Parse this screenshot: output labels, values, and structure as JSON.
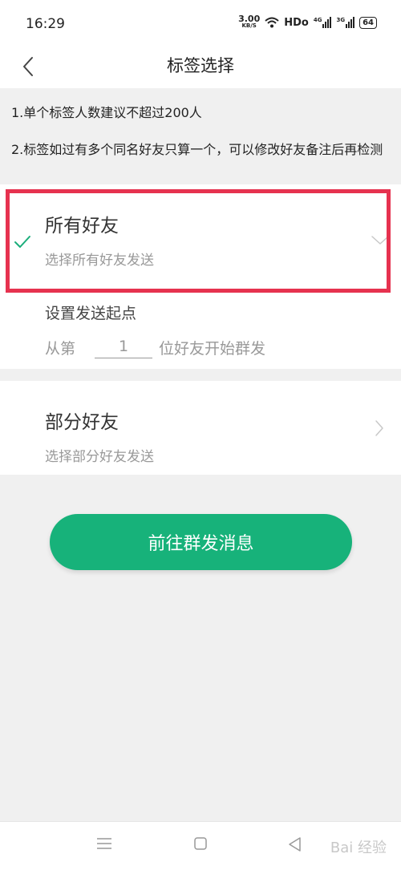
{
  "status_bar": {
    "time": "16:29",
    "speed_value": "3.00",
    "speed_unit": "KB/S",
    "hd_label": "HDo",
    "sig1_label": "4G",
    "sig2_label": "3G",
    "battery": "64"
  },
  "header": {
    "title": "标签选择"
  },
  "notes": {
    "line1": "1.单个标签人数建议不超过200人",
    "line2": "2.标签如过有多个同名好友只算一个，可以修改好友备注后再检测"
  },
  "option_all": {
    "title": "所有好友",
    "subtitle": "选择所有好友发送",
    "selected": true
  },
  "start_point": {
    "label": "设置发送起点",
    "prefix": "从第",
    "value": "1",
    "suffix": "位好友开始群发"
  },
  "option_part": {
    "title": "部分好友",
    "subtitle": "选择部分好友发送"
  },
  "action": {
    "button_label": "前往群发消息"
  },
  "watermark": "Bai 经验",
  "colors": {
    "accent": "#17b27a",
    "highlight": "#e6324f",
    "check": "#1aad7a"
  }
}
